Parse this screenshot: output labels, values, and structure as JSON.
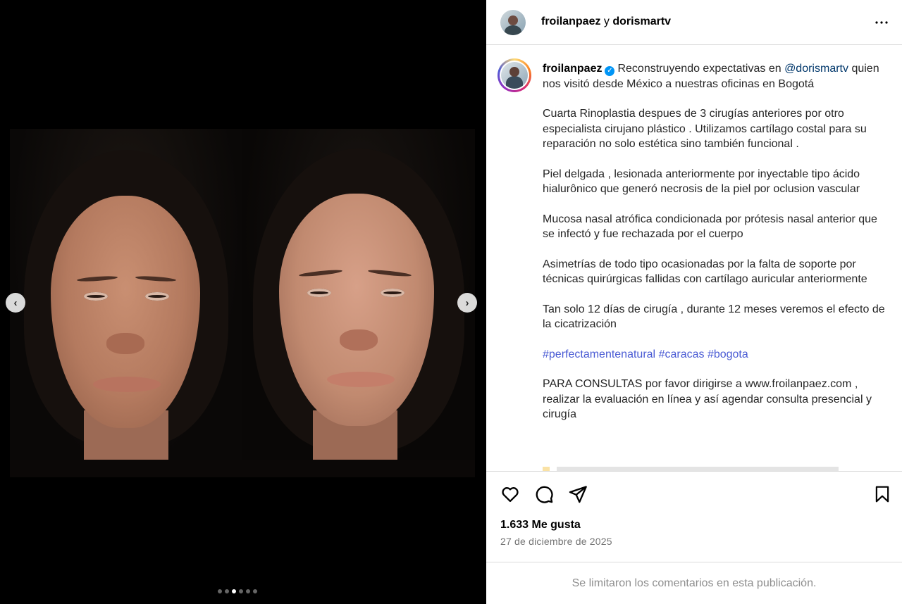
{
  "header": {
    "user1": "froilanpaez",
    "connector": "y",
    "user2": "dorismartv"
  },
  "caption": {
    "username": "froilanpaez",
    "intro_prefix": "Reconstruyendo expectativas en",
    "mention": "@dorismartv",
    "intro_suffix": "quien nos visitó desde México a nuestras oficinas en Bogotá",
    "p2": "Cuarta Rinoplastia despues de 3 cirugías anteriores por otro especialista cirujano plástico . Utilizamos cartílago costal para su reparación no solo estética sino también funcional .",
    "p3": "Piel delgada , lesionada anteriormente por inyectable tipo ácido hialurônico que generó necrosis de la piel por oclusion vascular",
    "p4": "Mucosa nasal atrófica condicionada por prótesis nasal anterior que se infectó y fue rechazada por el cuerpo",
    "p5": "Asimetrías de todo tipo ocasionadas por la falta de soporte por técnicas quirúrgicas fallidas con cartílago auricular anteriormente",
    "p6": "Tan solo 12 días de cirugía , durante 12 meses veremos el efecto de la cicatrización",
    "hashtags": [
      "#perfectamentenatural",
      "#caracas",
      "#bogota"
    ],
    "p8": "PARA CONSULTAS por favor dirigirse a www.froilanpaez.com , realizar la evaluación en línea y así agendar consulta presencial y cirugía"
  },
  "icons": {
    "more": "more-horizontal-icon",
    "verified": "verified-badge-icon",
    "like": "heart-icon",
    "comment": "comment-icon",
    "share": "send-icon",
    "save": "bookmark-icon",
    "prev": "chevron-left-icon",
    "next": "chevron-right-icon"
  },
  "stats": {
    "likes": "1.633 Me gusta",
    "date": "27 de diciembre de 2025"
  },
  "comments_notice": "Se limitaron los comentarios en esta publicación.",
  "carousel": {
    "count": 6,
    "active_index": 2
  },
  "colors": {
    "verified": "#0095f6",
    "mention": "#00376b",
    "hashtag": "#4a5bd4",
    "muted": "#737373"
  }
}
